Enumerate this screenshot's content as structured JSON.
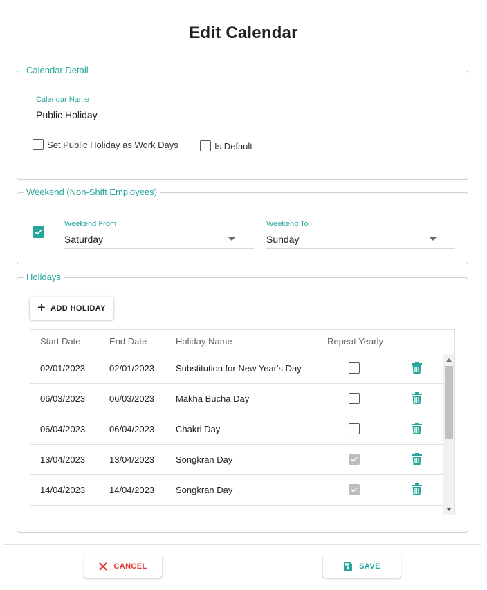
{
  "dialog": {
    "title": "Edit Calendar"
  },
  "calendar_detail": {
    "legend": "Calendar Detail",
    "name_label": "Calendar Name",
    "name_value": "Public Holiday",
    "work_days_label": "Set Public Holiday as Work Days",
    "work_days_checked": false,
    "is_default_label": "Is Default",
    "is_default_checked": false
  },
  "weekend": {
    "legend": "Weekend (Non-Shift Employees)",
    "enabled": true,
    "from_label": "Weekend From",
    "from_value": "Saturday",
    "to_label": "Weekend To",
    "to_value": "Sunday"
  },
  "holidays": {
    "legend": "Holidays",
    "add_label": "ADD HOLIDAY",
    "columns": [
      "Start Date",
      "End Date",
      "Holiday Name",
      "Repeat Yearly"
    ],
    "rows": [
      {
        "start": "02/01/2023",
        "end": "02/01/2023",
        "name": "Substitution for New Year's Day",
        "repeat": false
      },
      {
        "start": "06/03/2023",
        "end": "06/03/2023",
        "name": "Makha Bucha Day",
        "repeat": false
      },
      {
        "start": "06/04/2023",
        "end": "06/04/2023",
        "name": "Chakri Day",
        "repeat": false
      },
      {
        "start": "13/04/2023",
        "end": "13/04/2023",
        "name": "Songkran Day",
        "repeat": true
      },
      {
        "start": "14/04/2023",
        "end": "14/04/2023",
        "name": "Songkran Day",
        "repeat": true
      }
    ]
  },
  "footer": {
    "cancel_label": "CANCEL",
    "save_label": "SAVE"
  },
  "colors": {
    "accent": "#26a69a",
    "danger": "#e53935"
  },
  "icons": {
    "add": "plus-icon",
    "delete": "trash-icon",
    "cancel": "close-icon",
    "save": "floppy-disk-icon",
    "select": "caret-down-icon"
  }
}
